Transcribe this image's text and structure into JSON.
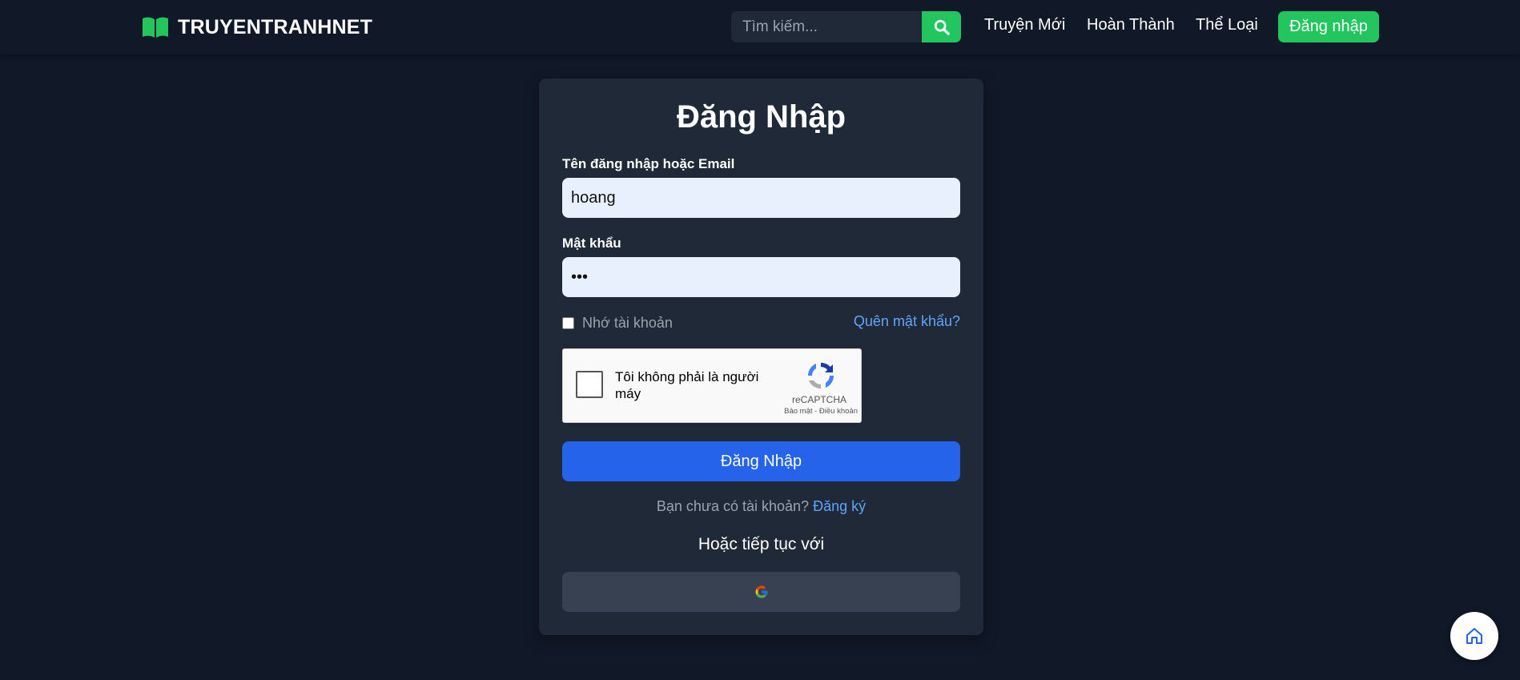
{
  "header": {
    "brand": "TRUYENTRANHNET",
    "search": {
      "placeholder": "Tìm kiếm...",
      "value": ""
    },
    "nav": [
      {
        "label": "Truyện Mới"
      },
      {
        "label": "Hoàn Thành"
      },
      {
        "label": "Thể Loại"
      }
    ],
    "login_label": "Đăng nhập"
  },
  "form": {
    "title": "Đăng Nhập",
    "username": {
      "label": "Tên đăng nhập hoặc Email",
      "value": "hoang"
    },
    "password": {
      "label": "Mật khẩu",
      "value": "•••"
    },
    "remember_label": "Nhớ tài khoản",
    "remember_checked": false,
    "forgot_label": "Quên mật khẩu?",
    "captcha": {
      "text": "Tôi không phải là người máy",
      "brand": "reCAPTCHA",
      "terms": "Bảo mật - Điều khoản"
    },
    "submit_label": "Đăng Nhập",
    "signup_prompt": "Bạn chưa có tài khoản?",
    "signup_link": "Đăng ký",
    "continue_with": "Hoặc tiếp tục với",
    "google_icon": "google-icon"
  },
  "fab": {
    "icon": "home-icon"
  },
  "colors": {
    "background": "#111827",
    "card": "#1f2937",
    "accent_green": "#22c55e",
    "primary_blue": "#2563eb",
    "link_blue": "#60a5fa",
    "input_bg": "#e8f0fe"
  }
}
